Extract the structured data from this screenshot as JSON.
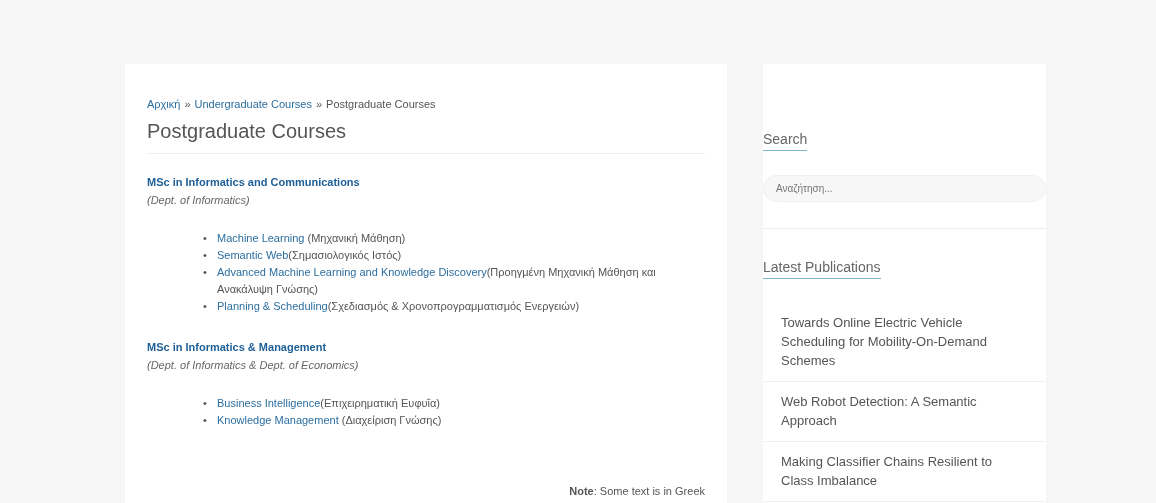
{
  "breadcrumb": [
    {
      "label": "Αρχική",
      "kind": "link"
    },
    {
      "label": "»",
      "kind": "separator"
    },
    {
      "label": "Undergraduate Courses",
      "kind": "link"
    },
    {
      "label": "»",
      "kind": "separator"
    },
    {
      "label": "Postgraduate Courses",
      "kind": "current"
    }
  ],
  "title": "Postgraduate Courses",
  "programs": [
    {
      "name": "MSc in Informatics and Communications",
      "department": "(Dept. of Informatics)",
      "courses": [
        {
          "marker": "•",
          "name": "Machine Learning",
          "greek": " (Μηχανική Μάθηση)"
        },
        {
          "marker": "•",
          "name": "Semantic Web",
          "greek": "(Σημασιολογικός Ιστός)"
        },
        {
          "marker": "•",
          "name": "Advanced Machine Learning and Knowledge Discovery",
          "greek": "(Προηγμένη Μηχανική Μάθηση και Ανακάλυψη Γνώσης)"
        },
        {
          "marker": "•",
          "name": "Planning & Scheduling",
          "greek": "(Σχεδιασμός & Χρονοπρογραμματισμός Ενεργειών)"
        }
      ]
    },
    {
      "name": "MSc in Informatics & Management",
      "department": "(Dept. of Informatics & Dept. of Economics)",
      "courses": [
        {
          "marker": "•",
          "name": "Business Intelligence",
          "greek": "(Επιχειρηματική Ευφυΐα)"
        },
        {
          "marker": "•",
          "name": "Knowledge Management",
          "greek": " (Διαχείριση Γνώσης)"
        }
      ]
    }
  ],
  "note": "**Note**: Some text is in Greek",
  "sidebar": {
    "search": {
      "title": "Search",
      "placeholder": "Αναζήτηση..."
    },
    "publications": {
      "title": "Latest Publications",
      "items": [
        "Towards Online Electric Vehicle Scheduling for Mobility-On-Demand Schemes",
        "Web Robot Detection: A Semantic Approach",
        "Making Classifier Chains Resilient to Class Imbalance"
      ]
    }
  }
}
